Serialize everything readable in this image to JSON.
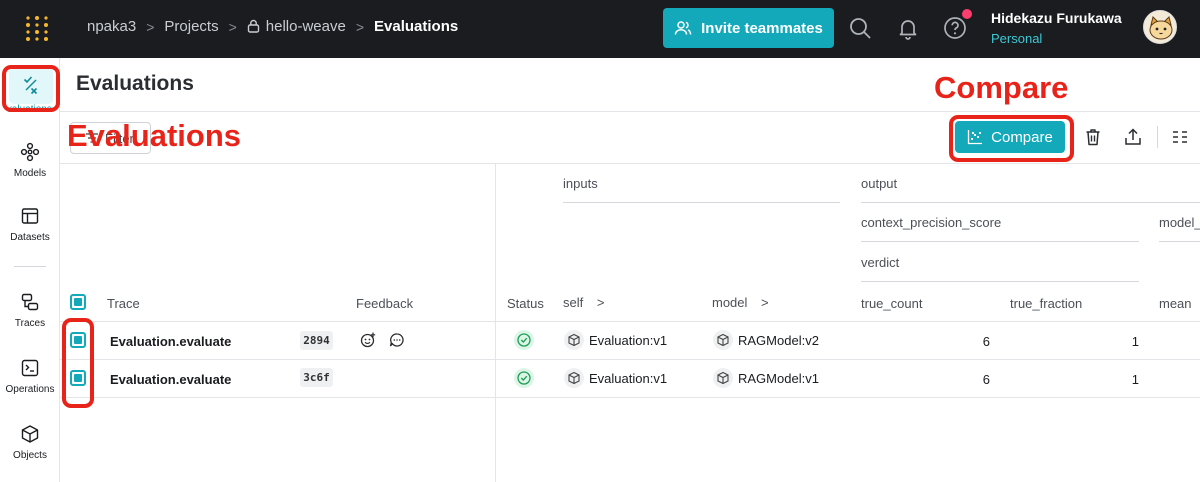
{
  "breadcrumb": {
    "entity": "npaka3",
    "section": "Projects",
    "project": "hello-weave",
    "page": "Evaluations"
  },
  "header": {
    "invite_label": "Invite teammates"
  },
  "user": {
    "name": "Hidekazu Furukawa",
    "team": "Personal"
  },
  "nav": {
    "active_label": "Evaluations",
    "items": [
      "Models",
      "Datasets",
      "Traces",
      "Operations",
      "Objects"
    ]
  },
  "page": {
    "title": "Evaluations",
    "filter_label": "Filter",
    "compare_label": "Compare"
  },
  "annotations": {
    "compare": "Compare",
    "evaluations": "Evaluations"
  },
  "table": {
    "group_inputs": "inputs",
    "group_output": "output",
    "sub_context_precision": "context_precision_score",
    "sub_verdict": "verdict",
    "sub_model": "model_",
    "col_trace": "Trace",
    "col_feedback": "Feedback",
    "col_status": "Status",
    "col_self": "self",
    "col_model": "model",
    "col_true_count": "true_count",
    "col_true_fraction": "true_fraction",
    "col_mean": "mean",
    "rows": [
      {
        "name": "Evaluation.evaluate",
        "id": "2894",
        "self": "Evaluation:v1",
        "model": "RAGModel:v2",
        "true_count": "6",
        "true_fraction": "1"
      },
      {
        "name": "Evaluation.evaluate",
        "id": "3c6f",
        "self": "Evaluation:v1",
        "model": "RAGModel:v1",
        "true_count": "6",
        "true_fraction": "1"
      }
    ]
  },
  "colors": {
    "accent": "#13a9ba",
    "annotation": "#e8241a",
    "topbar": "#1a1c1f"
  }
}
